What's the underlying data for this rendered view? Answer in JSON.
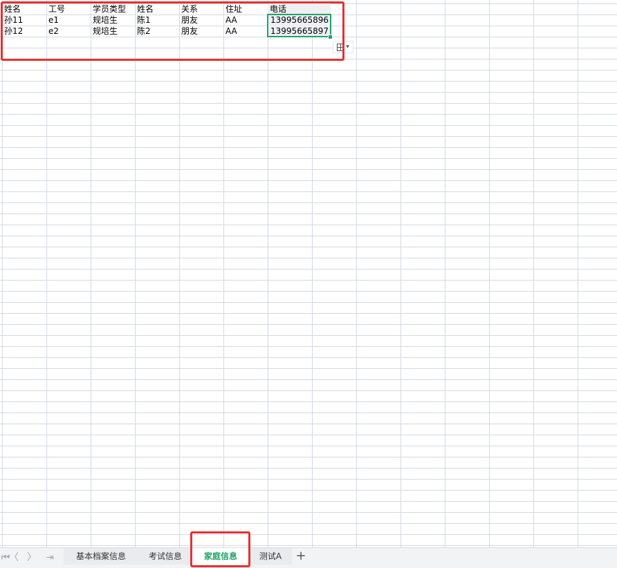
{
  "sheet": {
    "headers": [
      "姓名",
      "工号",
      "学员类型",
      "姓名",
      "关系",
      "住址",
      "电话"
    ],
    "rows": [
      [
        "孙11",
        "e1",
        "规培生",
        "陈1",
        "朋友",
        "AA",
        "13995665896"
      ],
      [
        "孙12",
        "e2",
        "规培生",
        "陈2",
        "朋友",
        "AA",
        "13995665897"
      ]
    ]
  },
  "tabs": {
    "first_icon": "⏮",
    "prev_icon": "〈",
    "next_icon": "〉",
    "last_icon": "⇥",
    "items": [
      {
        "label": "基本档案信息"
      },
      {
        "label": "考试信息"
      },
      {
        "label": "家庭信息"
      },
      {
        "label": "测试A"
      }
    ],
    "active_index": 2,
    "add_label": "+"
  },
  "colors": {
    "annotation": "#e6312f",
    "selection": "#21a366",
    "active_tab_text": "#21a366",
    "gridline": "#d4d8e3"
  },
  "icons": {
    "paste_options": "paste-options-icon",
    "paste_options_dropdown": "chevron-down-icon"
  }
}
